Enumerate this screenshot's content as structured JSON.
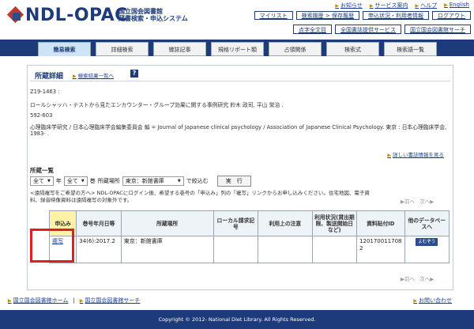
{
  "header": {
    "logo_text": "NDL-OPAC",
    "logo_sub1": "国立国会図書館",
    "logo_sub2": "蔵書検索・申込システム",
    "top_links": [
      "お知らせ",
      "サービス案内",
      "ヘルプ",
      "English"
    ],
    "nav_buttons": [
      "マイリスト",
      "検索履歴",
      "保存履歴",
      "申込状況・利用者情報",
      "ログアウト"
    ],
    "nav_buttons2": [
      "点字全文目",
      "全国書誌提供サービス",
      "国立国会図書館サーチ"
    ]
  },
  "tabs": [
    "簡易検索",
    "詳細検索",
    "雑誌記事",
    "規格リポート類",
    "占領関係",
    "検索式",
    "検索語一覧"
  ],
  "detail": {
    "title": "所蔵詳細",
    "back_link": "検索結果一覧へ",
    "help": "?",
    "lines": [
      "Z19-1463 :",
      "ロールシャッハ・テストから見たエンカウンター・グループ効果に関する事例研究 鈴木 政司, 平山 栄治 .",
      "592-603",
      "心理臨床学研究 / 日本心理臨床学会編集委員会 編 = Journal of Japanese clinical psychology / Association of Japanese Clinical Psychology. 東京 : 日本心理臨床学会,",
      "1983- ."
    ],
    "bib_link": "詳しい書誌情報を見る"
  },
  "holdings": {
    "title": "所蔵一覧",
    "sel_all1": "全て",
    "sel_all2": "全て",
    "vol_label": "巻",
    "location_label": "所蔵場所",
    "location_value": "東京：新館書庫",
    "narrow_label": "で絞込む",
    "run_button": "実　行",
    "note_line1": "<遠隔複写をご希望の方へ> NDL-OPACにログイン後、希望する巻号の「申込み」列の「複写」リンクからお申し込みください。住宅地図、電子資",
    "note_line2": "料、録音映像資料は遠隔複写の対象外です。",
    "prev": "前へ",
    "next": "次へ",
    "columns": [
      "申込み",
      "巻号年月日等",
      "所蔵場所",
      "ローカル請求記号",
      "利用上の注意",
      "利用状況(貸出期限、製送開始日など)",
      "資料貼付ID",
      "他のデータベースへ"
    ],
    "row": {
      "apply": "複写",
      "volume": "34(6):2017.2",
      "location": "東京：新館書庫",
      "local": "",
      "note": "",
      "status": "",
      "id": "1201700117082",
      "db_button": "よむぞう"
    }
  },
  "footer": {
    "link1": "国立国会図書館ホーム",
    "link2": "国立国会図書館サーチ",
    "ask": "お問い合わせ",
    "copyright": "Copyright © 2012- National Diet Library. All Rights Reserved."
  },
  "colors": {
    "navy": "#1d3b7a",
    "highlight": "#e02020",
    "apply_header": "#fff2a6"
  }
}
